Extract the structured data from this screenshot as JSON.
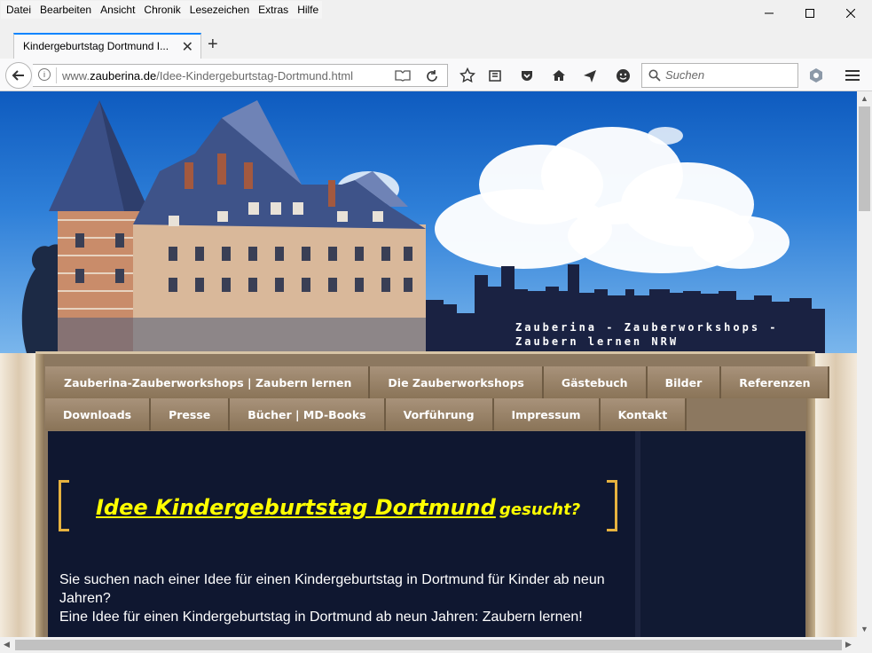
{
  "menubar": {
    "items": [
      "Datei",
      "Bearbeiten",
      "Ansicht",
      "Chronik",
      "Lesezeichen",
      "Extras",
      "Hilfe"
    ]
  },
  "window_controls": {
    "minimize": "—",
    "maximize": "☐",
    "close": "✕"
  },
  "tab": {
    "title": "Kindergeburtstag Dortmund I...",
    "close": "✕"
  },
  "newtab": "+",
  "urlbar": {
    "prefix": "www.",
    "domain": "zauberina.de",
    "path": "/Idee-Kindergeburtstag-Dortmund.html"
  },
  "search": {
    "placeholder": "Suchen"
  },
  "icons": {
    "back": "back-arrow-icon",
    "info": "info-icon",
    "reader": "reader-view-icon",
    "reload": "reload-icon",
    "bookmark": "star-icon",
    "library": "library-icon",
    "pocket": "pocket-icon",
    "home": "home-icon",
    "send": "send-icon",
    "emoji": "smiley-icon",
    "search": "search-icon",
    "extension": "extension-icon",
    "menu": "hamburger-menu-icon"
  },
  "page": {
    "tagline": "Zauberina - Zauberworkshops -\nZaubern lernen NRW",
    "nav_row1": [
      "Zauberina-Zauberworkshops | Zaubern lernen",
      "Die Zauberworkshops",
      "Gästebuch",
      "Bilder",
      "Referenzen"
    ],
    "nav_row2": [
      "Downloads",
      "Presse",
      "Bücher | MD-Books",
      "Vorführung",
      "Impressum",
      "Kontakt"
    ],
    "headline_main": "Idee Kindergeburtstag Dortmund",
    "headline_sub": "gesucht?",
    "paragraph_line1": "Sie suchen nach einer Idee für einen Kindergeburtstag in Dortmund für Kinder ab neun Jahren?",
    "paragraph_line2": "Eine Idee für einen Kindergeburtstag in Dortmund ab neun Jahren: Zaubern lernen!"
  },
  "colors": {
    "accent_tab": "#0a84ff",
    "content_bg": "#0f1730",
    "headline": "#ffff00",
    "bracket": "#e6b23f",
    "nav_button": "#9a8468"
  }
}
